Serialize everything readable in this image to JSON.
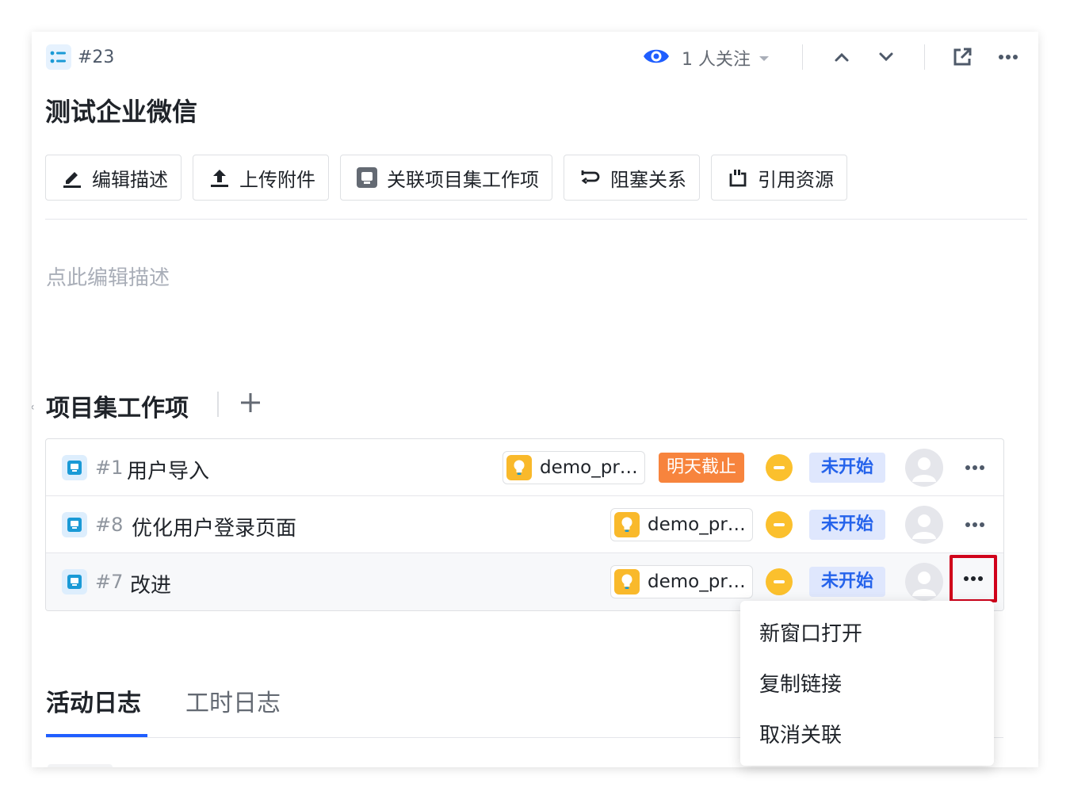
{
  "header": {
    "issue_number": "#23",
    "follow_label": "1 人关注"
  },
  "issue": {
    "title": "测试企业微信",
    "description_placeholder": "点此编辑描述"
  },
  "actions": [
    {
      "label": "编辑描述",
      "icon": "edit-icon"
    },
    {
      "label": "上传附件",
      "icon": "upload-icon"
    },
    {
      "label": "关联项目集工作项",
      "icon": "workitem-icon"
    },
    {
      "label": "阻塞关系",
      "icon": "block-relation-icon"
    },
    {
      "label": "引用资源",
      "icon": "quote-icon"
    }
  ],
  "section": {
    "title": "项目集工作项"
  },
  "rows": [
    {
      "number": "#1",
      "title": "用户导入",
      "project": "demo_pr…",
      "due": "明天截止",
      "status": "未开始"
    },
    {
      "number": "#8",
      "title": "优化用户登录页面",
      "project": "demo_pr…",
      "status": "未开始"
    },
    {
      "number": "#7",
      "title": "改进",
      "project": "demo_pr…",
      "status": "未开始"
    }
  ],
  "tabs": {
    "activity": "活动日志",
    "worklog": "工时日志"
  },
  "menu": {
    "items": [
      "新窗口打开",
      "复制链接",
      "取消关联"
    ]
  },
  "colors": {
    "accent": "#1f5eff",
    "status_bg": "#dfe7fd",
    "status_text": "#2563eb",
    "due_bg": "#f7843d",
    "priority": "#fbc02d",
    "project_icon": "#f9b92b",
    "highlight_border": "#d0021b"
  }
}
